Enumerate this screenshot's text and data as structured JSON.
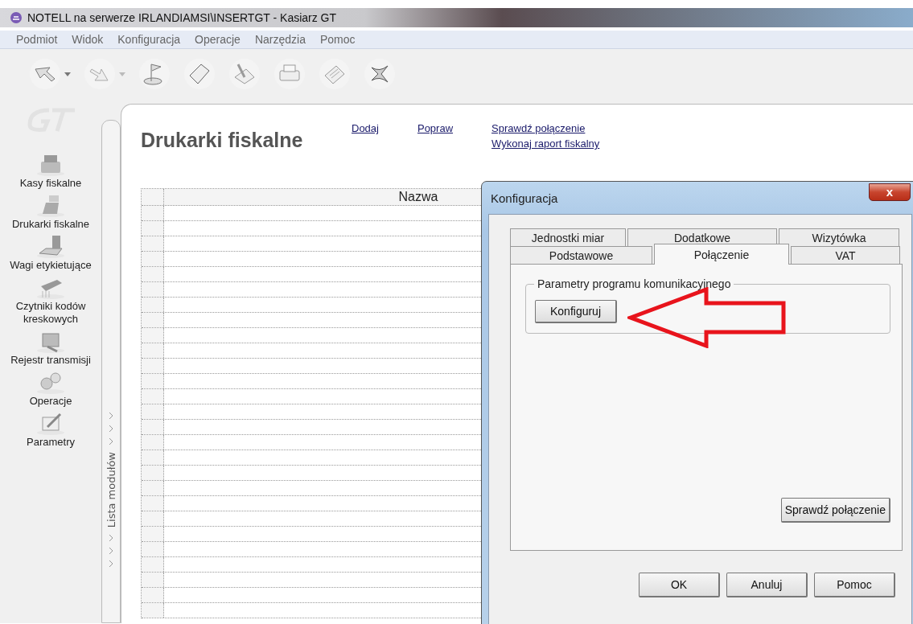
{
  "window": {
    "title": "NOTELL na serwerze IRLANDIAMSI\\INSERTGT - Kasiarz GT"
  },
  "menu": [
    "Podmiot",
    "Widok",
    "Konfiguracja",
    "Operacje",
    "Narzędzia",
    "Pomoc"
  ],
  "sidebar": {
    "items": [
      {
        "label": "Kasy fiskalne",
        "kind": "register"
      },
      {
        "label": "Drukarki fiskalne",
        "kind": "printer"
      },
      {
        "label": "Wagi etykietujące",
        "kind": "scale"
      },
      {
        "label": "Czytniki kodów kreskowych",
        "kind": "scanner"
      },
      {
        "label": "Rejestr transmisji",
        "kind": "transfer"
      },
      {
        "label": "Operacje",
        "kind": "gears"
      },
      {
        "label": "Parametry",
        "kind": "form"
      }
    ],
    "panel_label": "Lista modułów"
  },
  "page": {
    "title": "Drukarki fiskalne",
    "links": [
      [
        "Dodaj"
      ],
      [
        "Popraw"
      ],
      [
        "Sprawdź połączenie",
        "Wykonaj raport fiskalny"
      ]
    ],
    "table": {
      "columns": [
        "Nazwa"
      ]
    }
  },
  "dialog": {
    "title": "Konfiguracja",
    "close": "x",
    "tab_rows": [
      [
        {
          "label": "Jednostki miar",
          "selected": false
        },
        {
          "label": "Dodatkowe",
          "selected": false
        },
        {
          "label": "Wizytówka",
          "selected": false
        }
      ],
      [
        {
          "label": "Podstawowe",
          "selected": false
        },
        {
          "label": "Połączenie",
          "selected": true
        },
        {
          "label": "VAT",
          "selected": false
        }
      ]
    ],
    "group": {
      "label": "Parametry programu komunikacyjnego",
      "button": "Konfiguruj"
    },
    "test_button": "Sprawdź połączenie",
    "buttons": [
      "OK",
      "Anuluj",
      "Pomoc"
    ]
  }
}
